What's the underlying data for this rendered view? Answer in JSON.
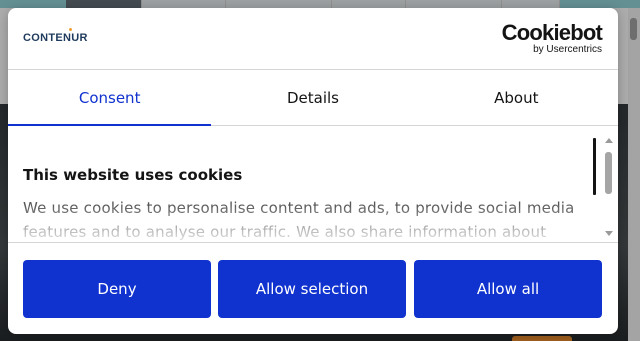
{
  "brand": {
    "site_logo_text": "CONTENUR",
    "cookiebot_word": "Cookiebot",
    "cookiebot_byline": "by Usercentrics"
  },
  "tabs": [
    {
      "label": "Consent",
      "active": true
    },
    {
      "label": "Details",
      "active": false
    },
    {
      "label": "About",
      "active": false
    }
  ],
  "content": {
    "heading": "This website uses cookies",
    "text": "We use cookies to personalise content and ads, to provide social media features and to analyse our traffic. We also share information about your"
  },
  "buttons": {
    "deny": "Deny",
    "allow_selection": "Allow selection",
    "allow_all": "Allow all"
  },
  "colors": {
    "accent": "#1032cf",
    "text": "#141414",
    "muted_text": "#555555"
  }
}
